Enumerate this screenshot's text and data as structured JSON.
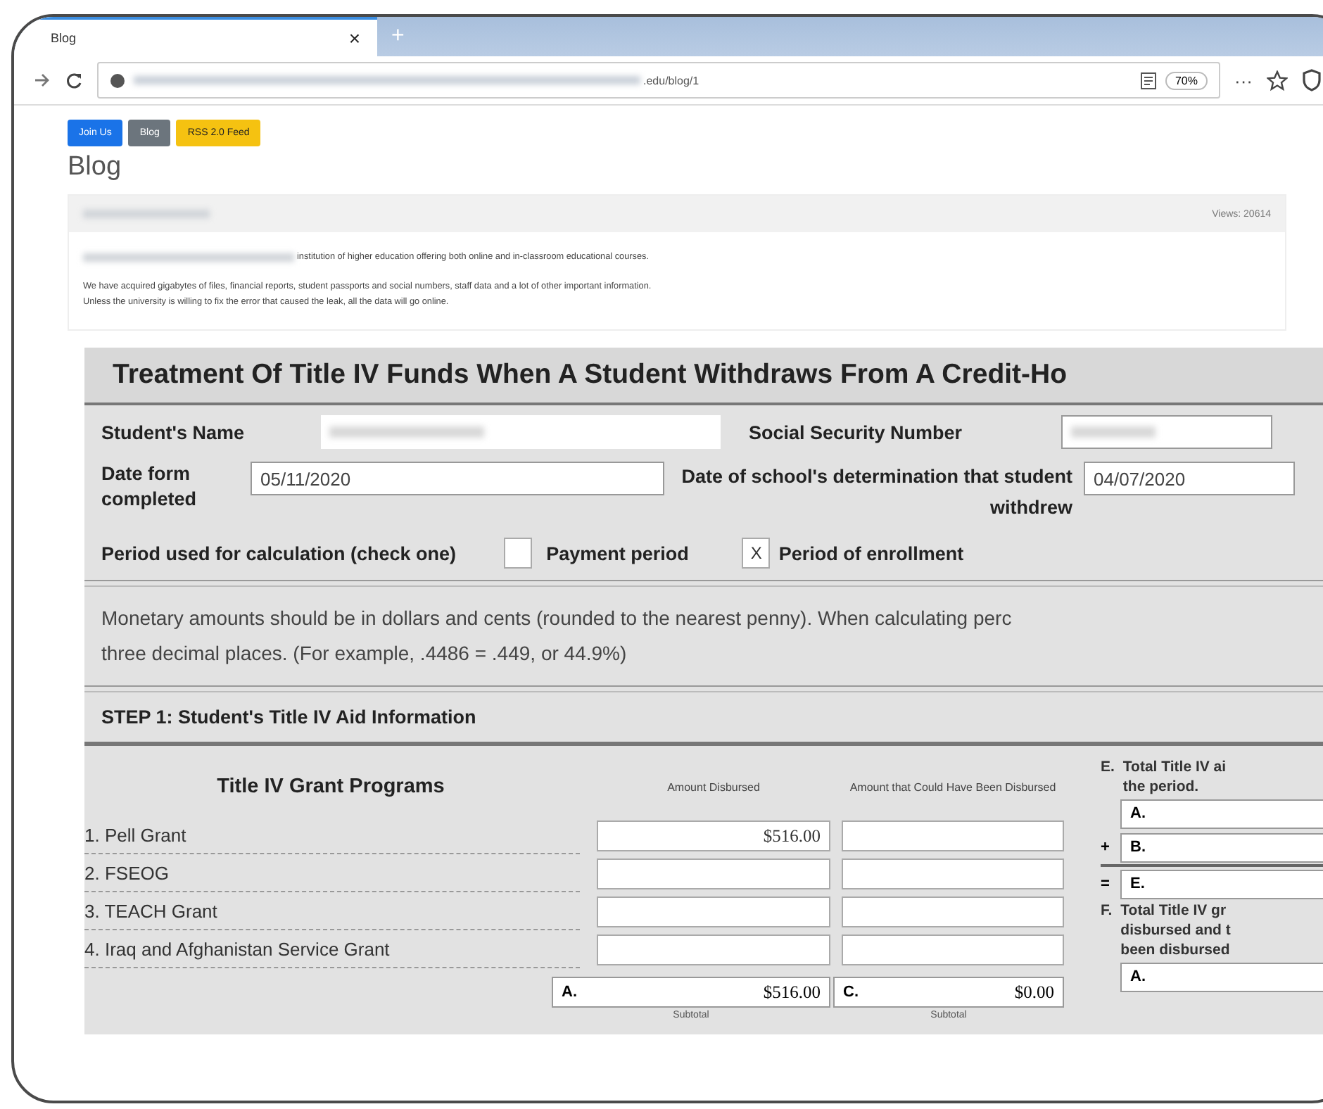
{
  "browser": {
    "tabs": [
      {
        "label": "Blog",
        "selected": true
      }
    ],
    "tab_close": "×",
    "new_tab": "+",
    "url": ".edu/blog/1",
    "zoom": "70%",
    "menu": "···"
  },
  "nav_buttons": [
    {
      "label": "Join Us",
      "kind": "primary"
    },
    {
      "label": "Blog",
      "kind": "secondary"
    },
    {
      "label": "RSS 2.0 Feed",
      "kind": "warning"
    }
  ],
  "heading": "Blog",
  "post": {
    "views": "Views: 20614",
    "intro": "institution of higher education offering both online and in-classroom educational courses.",
    "body_lines": [
      "We have acquired gigabytes of files, financial reports, student passports and social numbers, staff data and a lot of other important information.",
      "Unless the university is willing to fix the error that caused the leak, all the data will go online."
    ]
  },
  "form": {
    "title": "Treatment Of Title IV Funds When A Student Withdraws From A Credit-Ho",
    "student_name_label": "Student's Name",
    "ssn_label": "Social Security Number",
    "date_completed_label": "Date form completed",
    "date_completed": "05/11/2020",
    "determination_label": "Date of school's determination that student withdrew",
    "determination_date": "04/07/2020",
    "period_label": "Period used for calculation (check one)",
    "check_mark": "X",
    "period_options": [
      {
        "label": "Payment period",
        "checked": false
      },
      {
        "label": "Period of enrollment",
        "checked": true
      }
    ],
    "note_lines": [
      "Monetary amounts should be in dollars and cents (rounded to the nearest penny). When calculating perc",
      "three decimal places. (For example, .4486 = .449, or 44.9%)"
    ],
    "step1": {
      "title": "STEP 1: Student's Title IV Aid Information",
      "grants_heading": "Title IV Grant Programs",
      "col_disbursed": "Amount Disbursed",
      "col_could": "Amount that Could Have Been Disbursed",
      "grants": [
        {
          "name": "1. Pell Grant",
          "disbursed": "$516.00"
        },
        {
          "name": "2. FSEOG"
        },
        {
          "name": "3. TEACH Grant"
        },
        {
          "name": "4. Iraq and Afghanistan Service Grant"
        }
      ],
      "subtotals": [
        {
          "letter": "A.",
          "amount": "$516.00",
          "caption": "Subtotal"
        },
        {
          "letter": "C.",
          "amount": "$0.00",
          "caption": "Subtotal"
        }
      ],
      "side": {
        "e_letter": "E.",
        "e_lines": [
          "Total Title IV ai",
          "the period."
        ],
        "e_rows": [
          {
            "letter": "A."
          },
          {
            "op": "+",
            "letter": "B."
          },
          {
            "op": "=",
            "letter": "E."
          }
        ],
        "f_letter": "F.",
        "f_lines": [
          "Total Title IV gr",
          "disbursed and t",
          "been disbursed"
        ],
        "f_rows": [
          {
            "letter": "A."
          }
        ]
      }
    }
  }
}
